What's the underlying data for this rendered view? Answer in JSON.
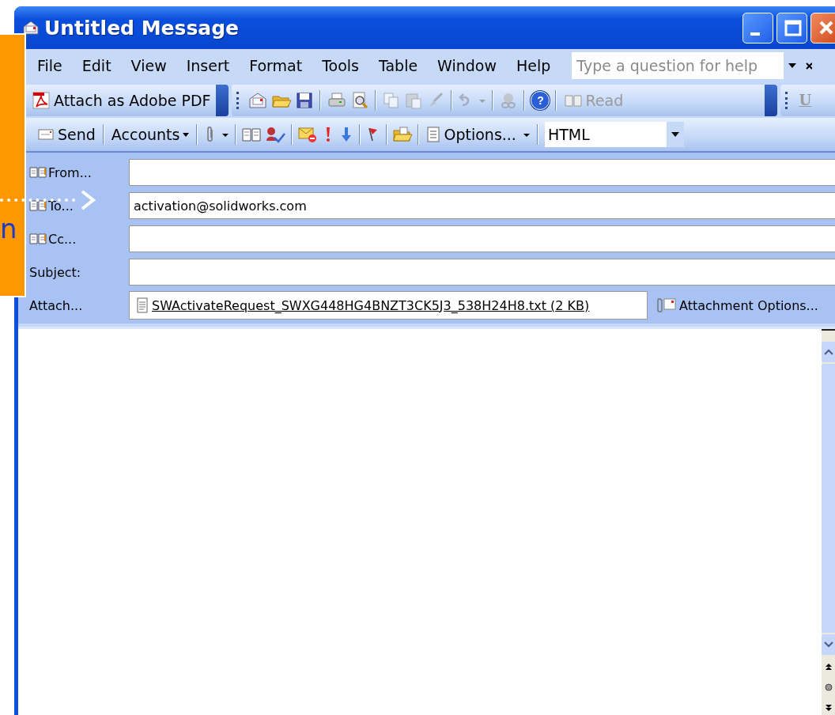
{
  "window": {
    "title": "Untitled Message"
  },
  "menu": [
    "File",
    "Edit",
    "View",
    "Insert",
    "Format",
    "Tools",
    "Table",
    "Window",
    "Help"
  ],
  "help_box": {
    "placeholder": "Type a question for help"
  },
  "pdf_toolbar": {
    "label": "Attach as Adobe PDF"
  },
  "help_button": {
    "label": "?"
  },
  "read_button": {
    "label": "Read",
    "disabled": true
  },
  "underline_button": {
    "label": "U",
    "disabled": true
  },
  "send_button": {
    "label": "Send"
  },
  "accounts_button": {
    "label": "Accounts"
  },
  "options_button": {
    "label": "Options..."
  },
  "format_select": {
    "value": "HTML"
  },
  "fields": [
    {
      "kind": "address",
      "label": "From..."
    },
    {
      "kind": "address",
      "label": "To...",
      "value": "activation@solidworks.com"
    },
    {
      "kind": "address",
      "label": "Cc..."
    },
    {
      "kind": "text",
      "label": "Subject:"
    },
    {
      "kind": "attachment",
      "label": "Attach...",
      "value": "SWActivateRequest_SWXG448HG4BNZT3CK5J3_538H24H8.txt (2 KB)"
    }
  ],
  "attachment_options": {
    "label": "Attachment Options..."
  },
  "callout": {
    "text": "n"
  }
}
